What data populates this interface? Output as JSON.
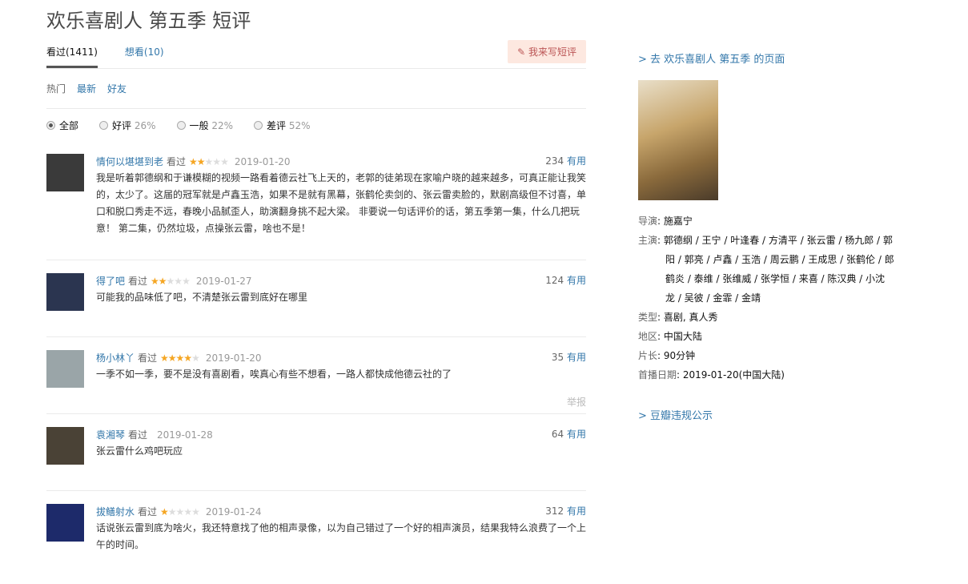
{
  "title": "欢乐喜剧人 第五季 短评",
  "tabs": [
    {
      "label": "看过(1411)"
    },
    {
      "label": "想看(10)"
    }
  ],
  "write_button": "我来写短评",
  "sort": [
    "热门",
    "最新",
    "好友"
  ],
  "filters": [
    {
      "label": "全部",
      "pct": ""
    },
    {
      "label": "好评",
      "pct": "26%"
    },
    {
      "label": "一般",
      "pct": "22%"
    },
    {
      "label": "差评",
      "pct": "52%"
    }
  ],
  "reviews": [
    {
      "user": "情何以堪堪到老",
      "status": "看过",
      "stars": 2,
      "date": "2019-01-20",
      "votes": "234",
      "useful": "有用",
      "text": "我是听着郭德纲和于谦模糊的视频一路看着德云社飞上天的，老郭的徒弟现在家喻户晓的越来越多，可真正能让我笑的，太少了。这届的冠军就是卢鑫玉浩，如果不是就有黑幕，张鹤伦卖剑的、张云雷卖脸的，默剧高级但不讨喜，单口和脱口秀走不远，春晚小品腻歪人，助演翻身挑不起大梁。 非要说一句话评价的话，第五季第一集，什么几把玩意！ 第二集，仍然垃圾，点操张云雷，啥也不是！",
      "avatar": "#3a3a3a"
    },
    {
      "user": "得了吧",
      "status": "看过",
      "stars": 2,
      "date": "2019-01-27",
      "votes": "124",
      "useful": "有用",
      "text": "可能我的品味低了吧，不清楚张云雷到底好在哪里",
      "avatar": "#2b3550"
    },
    {
      "user": "杨小林丫",
      "status": "看过",
      "stars": 4,
      "date": "2019-01-20",
      "votes": "35",
      "useful": "有用",
      "text": "一季不如一季，要不是没有喜剧看，唉真心有些不想看，一路人都快成他德云社的了",
      "avatar": "#9aa5a8",
      "report": "举报"
    },
    {
      "user": "袁湘琴",
      "status": "看过",
      "stars": 0,
      "date": "2019-01-28",
      "votes": "64",
      "useful": "有用",
      "text": "张云雷什么鸡吧玩应",
      "avatar": "#4a4236"
    },
    {
      "user": "拔鳝射水",
      "status": "看过",
      "stars": 1,
      "date": "2019-01-24",
      "votes": "312",
      "useful": "有用",
      "text": "话说张云雷到底为啥火，我还特意找了他的相声录像，以为自己错过了一个好的相声演员，结果我特么浪费了一个上午的时间。",
      "avatar": "#1d2a6a"
    }
  ],
  "side": {
    "page_link": "> 去 欢乐喜剧人 第五季 的页面",
    "director_label": "导演",
    "director": "施嘉宁",
    "cast_label": "主演",
    "cast": "郭德纲 / 王宁 / 叶逢春 / 方清平 / 张云雷 / 杨九郎 / 郭阳 / 郭亮 / 卢鑫 / 玉浩 / 周云鹏 / 王成思 / 张鹤伦 / 郎鹤炎 / 泰维 / 张维威 / 张学恒 / 来喜 / 陈汉典 / 小沈龙 / 吴彼 / 金霏 / 金靖",
    "genre_label": "类型",
    "genre": "喜剧, 真人秀",
    "region_label": "地区",
    "region": "中国大陆",
    "length_label": "片长",
    "length": "90分钟",
    "date_label": "首播日期",
    "date": "2019-01-20(中国大陆)",
    "violation_link": "> 豆瓣违规公示"
  }
}
